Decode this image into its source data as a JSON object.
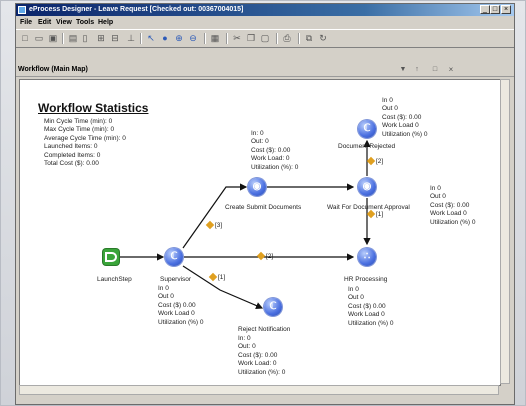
{
  "window": {
    "title": "eProcess Designer - Leave Request [Checked out: 00367004015]",
    "controls": [
      "_",
      "□",
      "×"
    ]
  },
  "menu": {
    "file": "File",
    "edit": "Edit",
    "view": "View",
    "tools": "Tools",
    "help": "Help"
  },
  "pane": {
    "title": "Workflow (Main Map)"
  },
  "stats": {
    "title": "Workflow Statistics",
    "lines": [
      "Min Cycle Time (min): 0",
      "Max Cycle Time (min): 0",
      "Average Cycle Time (min): 0",
      "Launched Items: 0",
      "Completed Items: 0",
      "Total Cost ($): 0.00"
    ]
  },
  "nodes": {
    "launch": {
      "label": "LaunchStep"
    },
    "supervisor": {
      "label": "Supervisor",
      "info": [
        "In 0",
        "Out 0",
        "Cost ($) 0.00",
        "Work Load 0",
        "Utilization (%) 0"
      ]
    },
    "create_submit": {
      "label": "Create Submit Documents",
      "info": [
        "In: 0",
        "Out: 0",
        "Cost ($):  0.00",
        "Work Load:  0",
        "Utilization (%): 0"
      ]
    },
    "reject": {
      "label": "Reject Notification",
      "info": [
        "In: 0",
        "Out: 0",
        "Cost ($):  0.00",
        "Work Load:  0",
        "Utilization (%): 0"
      ]
    },
    "doc_rejected": {
      "label": "Document Rejected",
      "info": [
        "In 0",
        "Out 0",
        "Cost ($): 0.00",
        "Work Load 0",
        "Utilization (%) 0"
      ]
    },
    "wait_approval": {
      "label": "Wait For Document Approval",
      "info": [
        "In 0",
        "Out 0",
        "Cost ($): 0.00",
        "Work Load 0",
        "Utilization (%) 0"
      ]
    },
    "hr": {
      "label": "HR Processing",
      "info": [
        "In 0",
        "Out 0",
        "Cost ($) 0.00",
        "Work Load 0",
        "Utilization (%) 0"
      ]
    }
  },
  "edges": {
    "sup_create": "[3]",
    "sup_hr": "[2]",
    "sup_reject": "[1]",
    "wait_rejected": "[2]",
    "wait_hr": "[1]"
  }
}
